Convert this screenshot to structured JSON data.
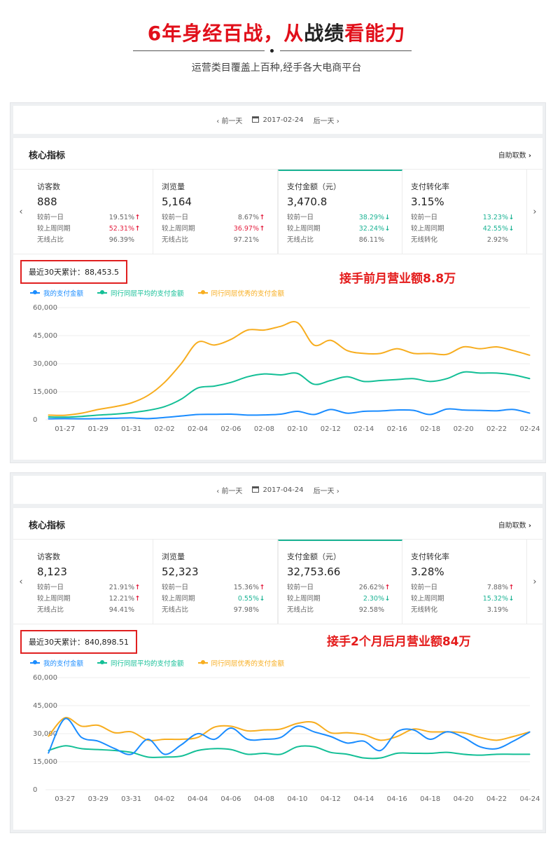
{
  "hero": {
    "title_part1": "6年身经百战，从",
    "title_part2": "战绩",
    "title_part3": "看能力",
    "subtitle": "运营类目覆盖上百种,经手各大电商平台"
  },
  "colors": {
    "mine": "#1a8cff",
    "avg": "#13bf96",
    "best": "#f7ad1f",
    "accent": "#e41b1b",
    "tab_active": "#1bb394"
  },
  "panels": [
    {
      "prev_day": "前一天",
      "date": "2017-02-24",
      "next_day": "后一天",
      "card_title": "核心指标",
      "self_fetch": "自助取数",
      "kpis": [
        {
          "title": "访客数",
          "value": "888",
          "rows": [
            {
              "label": "较前一日",
              "pct": "19.51%",
              "dir": "up"
            },
            {
              "label": "较上周同期",
              "pct": "52.31%",
              "dir": "up",
              "red": true
            },
            {
              "label": "无线占比",
              "pct": "96.39%",
              "dir": ""
            }
          ]
        },
        {
          "title": "浏览量",
          "value": "5,164",
          "rows": [
            {
              "label": "较前一日",
              "pct": "8.67%",
              "dir": "up"
            },
            {
              "label": "较上周同期",
              "pct": "36.97%",
              "dir": "up",
              "red": true
            },
            {
              "label": "无线占比",
              "pct": "97.21%",
              "dir": ""
            }
          ]
        },
        {
          "title": "支付金额（元）",
          "value": "3,470.8",
          "active": true,
          "rows": [
            {
              "label": "较前一日",
              "pct": "38.29%",
              "dir": "down"
            },
            {
              "label": "较上周同期",
              "pct": "32.24%",
              "dir": "down"
            },
            {
              "label": "无线占比",
              "pct": "86.11%",
              "dir": ""
            }
          ]
        },
        {
          "title": "支付转化率",
          "value": "3.15%",
          "rows": [
            {
              "label": "较前一日",
              "pct": "13.23%",
              "dir": "down"
            },
            {
              "label": "较上周同期",
              "pct": "42.55%",
              "dir": "down"
            },
            {
              "label": "无线转化",
              "pct": "2.92%",
              "dir": ""
            }
          ]
        }
      ],
      "total_label": "最近30天累计：88,453.5",
      "annotation": "接手前月营业额8.8万"
    },
    {
      "prev_day": "前一天",
      "date": "2017-04-24",
      "next_day": "后一天",
      "card_title": "核心指标",
      "self_fetch": "自助取数",
      "kpis": [
        {
          "title": "访客数",
          "value": "8,123",
          "rows": [
            {
              "label": "较前一日",
              "pct": "21.91%",
              "dir": "up"
            },
            {
              "label": "较上周同期",
              "pct": "12.21%",
              "dir": "up"
            },
            {
              "label": "无线占比",
              "pct": "94.41%",
              "dir": ""
            }
          ]
        },
        {
          "title": "浏览量",
          "value": "52,323",
          "rows": [
            {
              "label": "较前一日",
              "pct": "15.36%",
              "dir": "up"
            },
            {
              "label": "较上周同期",
              "pct": "0.55%",
              "dir": "down"
            },
            {
              "label": "无线占比",
              "pct": "97.98%",
              "dir": ""
            }
          ]
        },
        {
          "title": "支付金额（元）",
          "value": "32,753.66",
          "active": true,
          "rows": [
            {
              "label": "较前一日",
              "pct": "26.62%",
              "dir": "up"
            },
            {
              "label": "较上周同期",
              "pct": "2.30%",
              "dir": "down"
            },
            {
              "label": "无线占比",
              "pct": "92.58%",
              "dir": ""
            }
          ]
        },
        {
          "title": "支付转化率",
          "value": "3.28%",
          "rows": [
            {
              "label": "较前一日",
              "pct": "7.88%",
              "dir": "up"
            },
            {
              "label": "较上周同期",
              "pct": "15.32%",
              "dir": "down"
            },
            {
              "label": "无线转化",
              "pct": "3.19%",
              "dir": ""
            }
          ]
        }
      ],
      "total_label": "最近30天累计：840,898.51",
      "annotation": "接手2个月后月营业额84万"
    }
  ],
  "chart_data": [
    {
      "type": "line",
      "legend": [
        "我的支付金额",
        "同行同层平均的支付金额",
        "同行同层优秀的支付金额"
      ],
      "ylim": [
        0,
        60000
      ],
      "yticks": [
        0,
        15000,
        30000,
        45000,
        60000
      ],
      "ytick_labels": [
        "0",
        "15,000",
        "30,000",
        "45,000",
        "60,000"
      ],
      "xtick_labels": [
        "01-27",
        "01-29",
        "01-31",
        "02-02",
        "02-04",
        "02-06",
        "02-08",
        "02-10",
        "02-12",
        "02-14",
        "02-16",
        "02-18",
        "02-20",
        "02-22",
        "02-24"
      ],
      "x": [
        "01-26",
        "01-27",
        "01-28",
        "01-29",
        "01-30",
        "01-31",
        "02-01",
        "02-02",
        "02-03",
        "02-04",
        "02-05",
        "02-06",
        "02-07",
        "02-08",
        "02-09",
        "02-10",
        "02-11",
        "02-12",
        "02-13",
        "02-14",
        "02-15",
        "02-16",
        "02-17",
        "02-18",
        "02-19",
        "02-20",
        "02-21",
        "02-22",
        "02-23",
        "02-24"
      ],
      "series": [
        {
          "name": "我的支付金额",
          "values": [
            500,
            600,
            500,
            600,
            800,
            1000,
            600,
            1200,
            2000,
            2800,
            2900,
            3000,
            2500,
            2600,
            3000,
            4500,
            2800,
            5500,
            3500,
            4500,
            4700,
            5200,
            5000,
            2800,
            5700,
            5200,
            5000,
            4800,
            5500,
            3500
          ]
        },
        {
          "name": "同行同层平均的支付金额",
          "values": [
            1500,
            1400,
            1800,
            2500,
            3000,
            3800,
            5000,
            7000,
            11000,
            17000,
            18000,
            20000,
            23000,
            24500,
            24000,
            24800,
            19000,
            21000,
            23000,
            20500,
            21000,
            21500,
            22000,
            20500,
            22000,
            25500,
            25000,
            25000,
            24000,
            22000
          ]
        },
        {
          "name": "同行同层优秀的支付金额",
          "values": [
            2500,
            2400,
            3500,
            5500,
            7000,
            9000,
            13000,
            20000,
            30000,
            41500,
            40000,
            43000,
            48000,
            48000,
            50000,
            52000,
            40000,
            42500,
            37000,
            35500,
            35500,
            38000,
            35500,
            35500,
            35000,
            39000,
            38000,
            39000,
            37000,
            34500
          ]
        }
      ]
    },
    {
      "type": "line",
      "legend": [
        "我的支付金额",
        "同行同层平均的支付金额",
        "同行同层优秀的支付金额"
      ],
      "ylim": [
        0,
        60000
      ],
      "yticks": [
        0,
        15000,
        30000,
        45000,
        60000
      ],
      "ytick_labels": [
        "0",
        "15,000",
        "30,000",
        "45,000",
        "60,000"
      ],
      "xtick_labels": [
        "03-27",
        "03-29",
        "03-31",
        "04-02",
        "04-04",
        "04-06",
        "04-08",
        "04-10",
        "04-12",
        "04-14",
        "04-16",
        "04-18",
        "04-20",
        "04-22",
        "04-24"
      ],
      "x": [
        "03-26",
        "03-27",
        "03-28",
        "03-29",
        "03-30",
        "03-31",
        "04-01",
        "04-02",
        "04-03",
        "04-04",
        "04-05",
        "04-06",
        "04-07",
        "04-08",
        "04-09",
        "04-10",
        "04-11",
        "04-12",
        "04-13",
        "04-14",
        "04-15",
        "04-16",
        "04-17",
        "04-18",
        "04-19",
        "04-20",
        "04-21",
        "04-22",
        "04-23",
        "04-24"
      ],
      "series": [
        {
          "name": "我的支付金额",
          "values": [
            19500,
            38000,
            28000,
            26000,
            22000,
            19000,
            27000,
            19000,
            24000,
            30000,
            27000,
            33000,
            27000,
            27000,
            28000,
            34000,
            31000,
            28500,
            25000,
            26000,
            21000,
            31000,
            32000,
            27000,
            31000,
            28000,
            23000,
            22000,
            26000,
            31000
          ]
        },
        {
          "name": "同行同层平均的支付金额",
          "values": [
            21000,
            23500,
            22000,
            21500,
            21000,
            20000,
            17500,
            17500,
            18000,
            21000,
            22000,
            21500,
            19000,
            19500,
            19000,
            23000,
            23000,
            20000,
            19000,
            17000,
            17000,
            19500,
            19500,
            19500,
            20000,
            19000,
            18500,
            19000,
            19000,
            19000
          ]
        },
        {
          "name": "同行同层优秀的支付金额",
          "values": [
            28500,
            38500,
            34000,
            34500,
            30500,
            31000,
            26500,
            27000,
            27000,
            28000,
            33500,
            34000,
            31500,
            32000,
            32500,
            35500,
            36000,
            30500,
            30500,
            29500,
            26500,
            28500,
            32500,
            31000,
            31000,
            30500,
            28000,
            26500,
            28500,
            31000
          ]
        }
      ]
    }
  ]
}
